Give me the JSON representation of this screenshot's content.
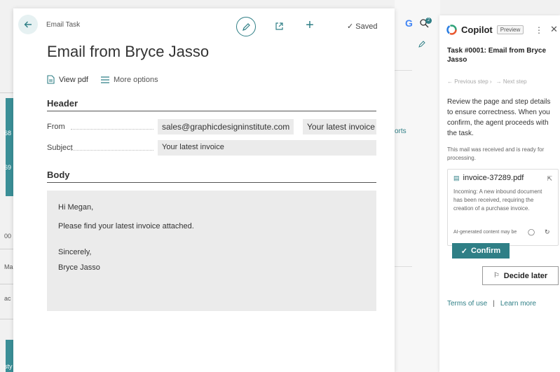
{
  "background": {
    "fragments": [
      "68",
      "69",
      "00",
      "Ma",
      "ac",
      "sty"
    ],
    "mid_link": "orts"
  },
  "card": {
    "breadcrumb": "Email Task",
    "saved_label": "Saved",
    "title": "Email from Bryce Jasso",
    "actions": {
      "view_pdf": "View pdf",
      "more_options": "More options"
    },
    "header_section": "Header",
    "from_label": "From",
    "from_value": "sales@graphicdesigninstitute.com",
    "from_value2": "Your latest invoice",
    "subject_label": "Subject",
    "subject_value": "Your latest invoice",
    "body_section": "Body",
    "body": {
      "greeting": "Hi Megan,",
      "line1": "Please find your latest invoice attached.",
      "closing": "Sincerely,",
      "signature": "Bryce Jasso"
    }
  },
  "side_icons": {
    "google": "G",
    "badge_count": "2"
  },
  "copilot": {
    "title": "Copilot",
    "preview_badge": "Preview",
    "task_title": "Task #0001: Email from Bryce Jasso",
    "previous_step": "Previous step",
    "next_step": "Next step",
    "description": "Review the page and step details to ensure correctness. When you confirm, the agent proceeds with the task.",
    "note": "This mail was received and is ready for processing.",
    "file_name": "invoice-37289.pdf",
    "card_text": "Incoming: A new inbound document has been received, requiring the creation of a purchase invoice.",
    "ai_disclaimer": "AI-generated content may be",
    "confirm_label": "Confirm",
    "decide_later_label": "Decide later",
    "terms_link": "Terms of use",
    "separator": "|",
    "learn_more_link": "Learn more"
  },
  "colors": {
    "accent": "#2f7f86",
    "field_bg": "#ebebeb"
  }
}
